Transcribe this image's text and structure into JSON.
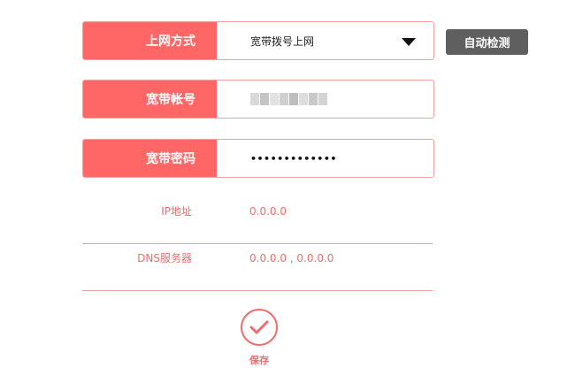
{
  "form": {
    "connection_type": {
      "label": "上网方式",
      "value": "宽带拨号上网",
      "icon": "caret-down-icon"
    },
    "account": {
      "label": "宽带帐号",
      "value_redacted_colors": [
        "#d9d9d9",
        "#c4c4c4",
        "#e2e2e2",
        "#cfcfcf",
        "#bdbdbd",
        "#dddddd",
        "#c9c9c9",
        "#d4d4d4"
      ]
    },
    "password": {
      "label": "宽带密码",
      "value": "•••••••••••••"
    }
  },
  "auto_detect": {
    "label": "自动检测"
  },
  "info": {
    "ip": {
      "label": "IP地址",
      "value": "0.0.0.0"
    },
    "dns": {
      "label": "DNS服务器",
      "value": "0.0.0.0 , 0.0.0.0"
    }
  },
  "save": {
    "label": "保存",
    "icon": "checkmark-icon"
  },
  "colors": {
    "accent": "#ff6666",
    "border": "#f2a0a0",
    "info_text": "#f36b6b",
    "button_dark": "#5f5f5f"
  }
}
